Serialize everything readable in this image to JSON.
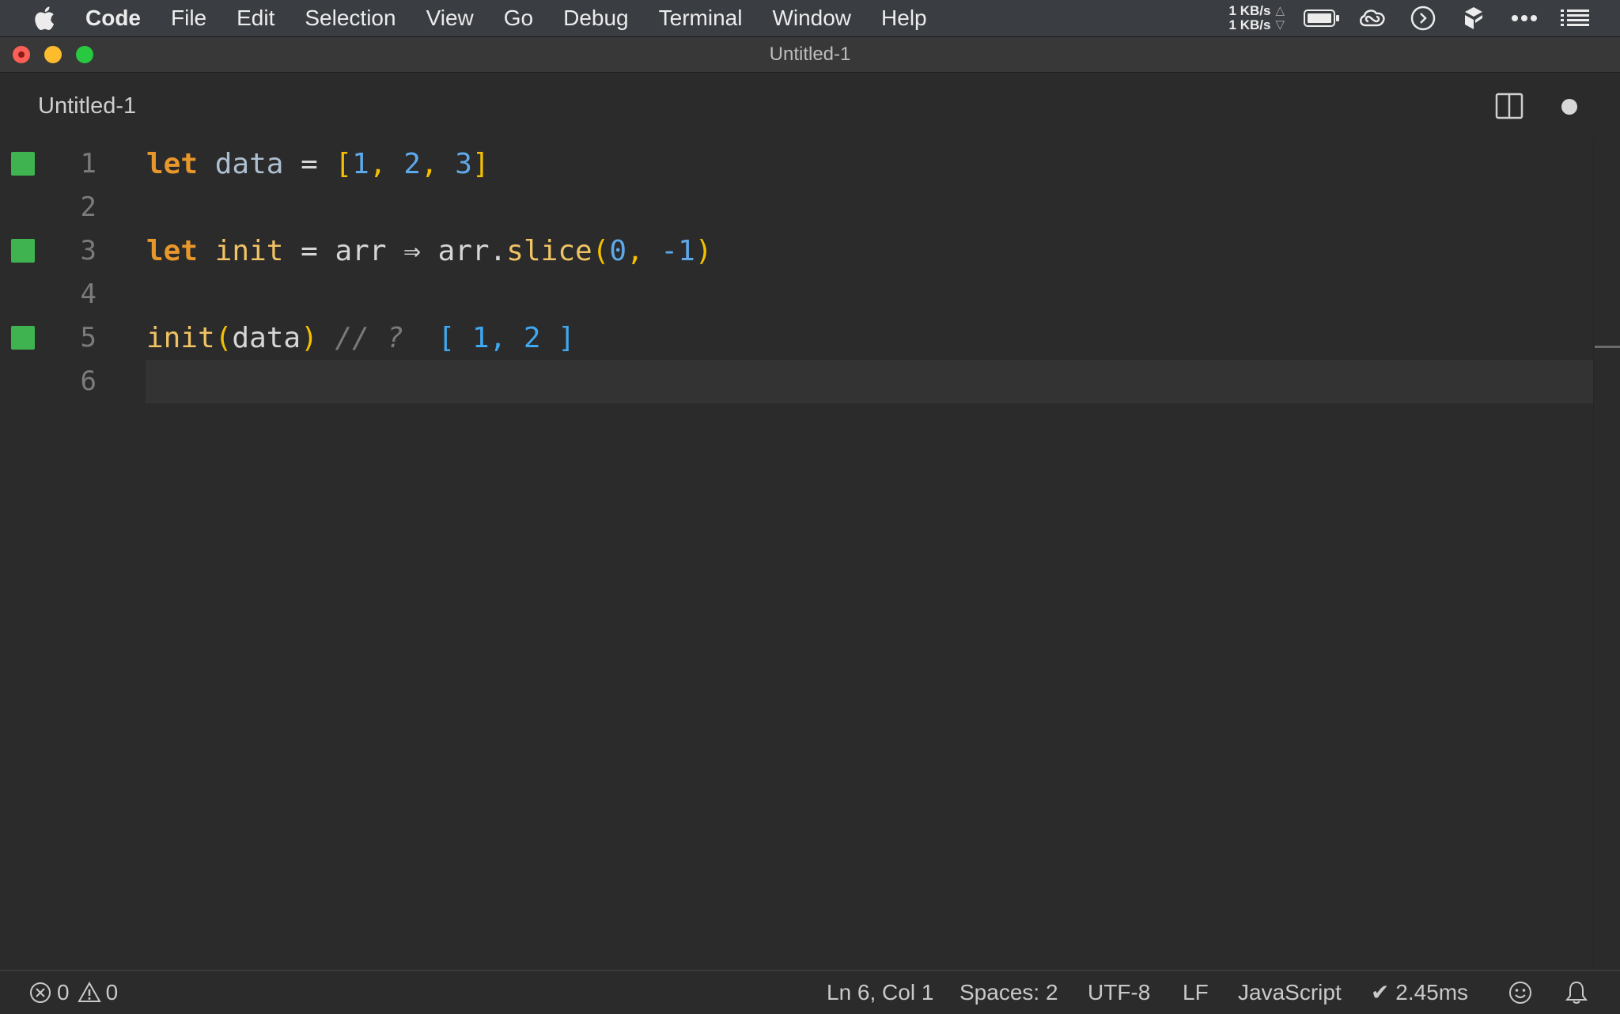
{
  "menubar": {
    "app_name": "Code",
    "items": [
      "File",
      "Edit",
      "Selection",
      "View",
      "Go",
      "Debug",
      "Terminal",
      "Window",
      "Help"
    ],
    "net_up": "1 KB/s",
    "net_down": "1 KB/s",
    "net_up_arrow": "△",
    "net_down_arrow": "▽",
    "tray_icons": [
      "battery-icon",
      "creative-cloud-icon",
      "quokka-icon",
      "dropbox-icon",
      "more-icon",
      "list-icon"
    ]
  },
  "window": {
    "title": "Untitled-1"
  },
  "tab": {
    "label": "Untitled-1"
  },
  "editor": {
    "lines": [
      {
        "number": "1",
        "has_marker": true
      },
      {
        "number": "2",
        "has_marker": false
      },
      {
        "number": "3",
        "has_marker": true
      },
      {
        "number": "4",
        "has_marker": false
      },
      {
        "number": "5",
        "has_marker": true
      },
      {
        "number": "6",
        "has_marker": false
      }
    ],
    "line1": {
      "kw": "let",
      "name": "data",
      "eq": "=",
      "open": "[",
      "v1": "1",
      "c1": ",",
      "v2": "2",
      "c2": ",",
      "v3": "3",
      "close": "]"
    },
    "line3": {
      "kw": "let",
      "name": "init",
      "eq": "=",
      "param": "arr",
      "arrow": "⇒",
      "obj": "arr",
      "dot": ".",
      "method": "slice",
      "open": "(",
      "a1": "0",
      "comma": ",",
      "a2": "-1",
      "close": ")"
    },
    "line5": {
      "fn": "init",
      "open": "(",
      "arg": "data",
      "close": ")",
      "comment": "// ?",
      "result": "[ 1, 2 ]"
    },
    "current_line": 6,
    "marker_color": "#3fb34f"
  },
  "statusbar": {
    "errors": "0",
    "warnings": "0",
    "position": "Ln 6, Col 1",
    "spaces": "Spaces: 2",
    "encoding": "UTF-8",
    "eol": "LF",
    "language": "JavaScript",
    "timing": "✔ 2.45ms"
  },
  "colors": {
    "keyword": "#e8972b",
    "function": "#f0c365",
    "number": "#5ea9ea",
    "bracket": "#f4c000",
    "result": "#3ea8f0"
  }
}
